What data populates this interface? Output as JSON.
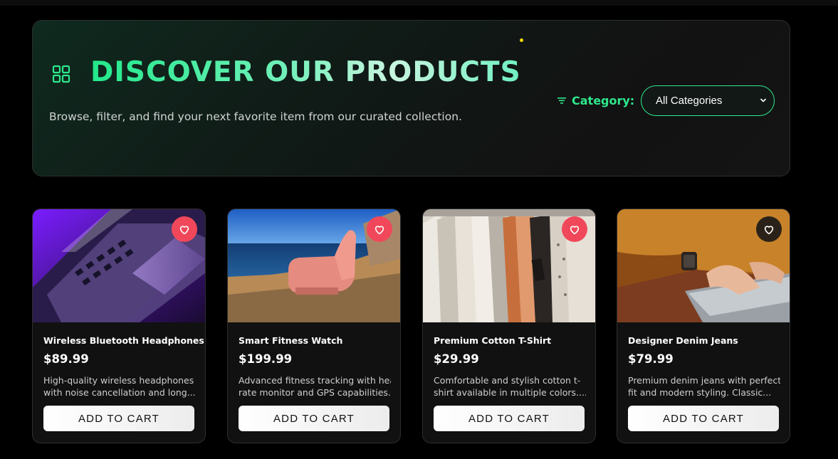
{
  "header": {
    "title": "DISCOVER OUR PRODUCTS",
    "subtitle": "Browse, filter, and find your next favorite item from our curated collection.",
    "grid_icon": "grid-icon",
    "filter": {
      "icon": "filter-icon",
      "label": "Category:",
      "selected": "All Categories"
    }
  },
  "colors": {
    "accent": "#2ee88c",
    "heart_active": "#f0485a",
    "background": "#000000"
  },
  "products": [
    {
      "name": "Wireless Bluetooth Headphones",
      "price": "$89.99",
      "desc_line1": "High-quality wireless headphones",
      "desc_line2": "with noise cancellation and long...",
      "button": "ADD TO CART",
      "favorited": true
    },
    {
      "name": "Smart Fitness Watch",
      "price": "$199.99",
      "desc_line1": "Advanced fitness tracking with heart",
      "desc_line2": "rate monitor and GPS capabilities....",
      "button": "ADD TO CART",
      "favorited": true
    },
    {
      "name": "Premium Cotton T-Shirt",
      "price": "$29.99",
      "desc_line1": "Comfortable and stylish cotton t-",
      "desc_line2": "shirt available in multiple colors....",
      "button": "ADD TO CART",
      "favorited": true
    },
    {
      "name": "Designer Denim Jeans",
      "price": "$79.99",
      "desc_line1": "Premium denim jeans with perfect",
      "desc_line2": "fit and modern styling. Classic...",
      "button": "ADD TO CART",
      "favorited": false
    }
  ]
}
